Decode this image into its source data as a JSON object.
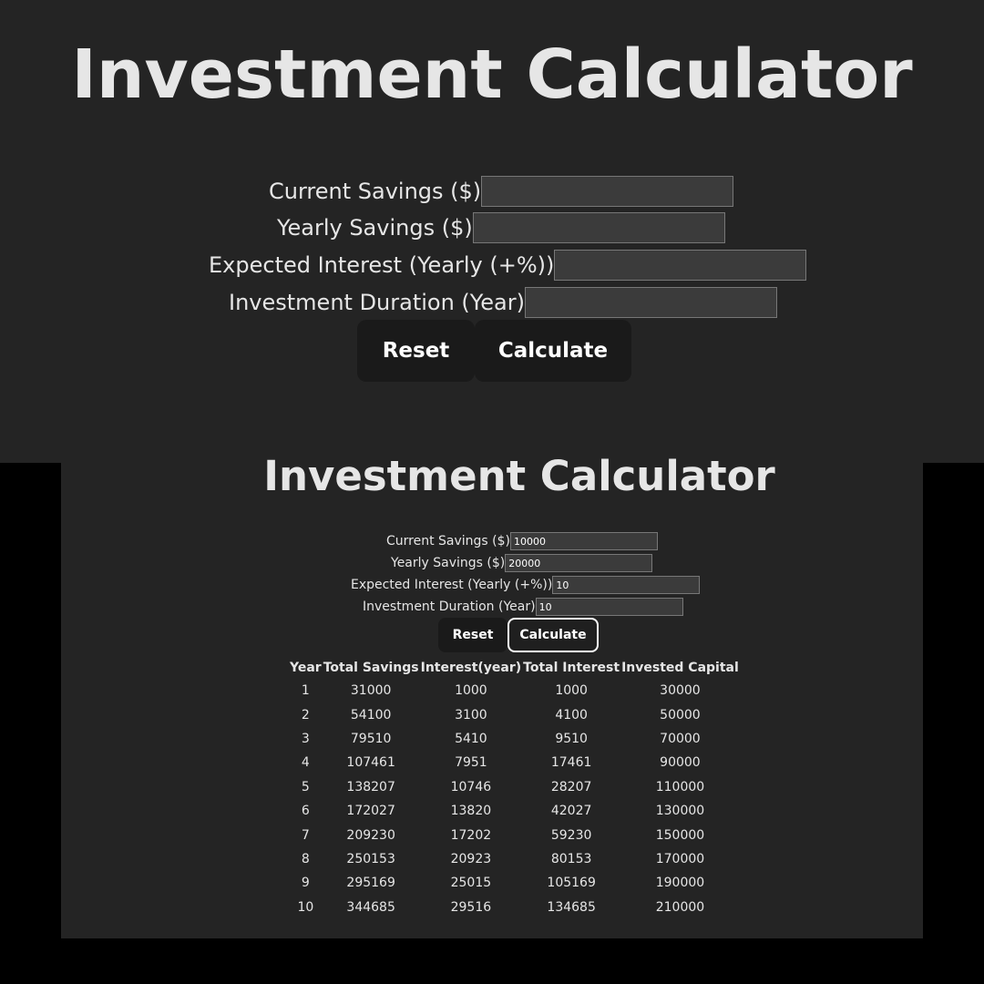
{
  "top": {
    "title": "Investment Calculator",
    "labels": {
      "current_savings": "Current Savings ($)",
      "yearly_savings": "Yearly Savings ($)",
      "expected_interest": "Expected Interest (Yearly (+%))",
      "duration": "Investment Duration (Year)"
    },
    "values": {
      "current_savings": "",
      "yearly_savings": "",
      "expected_interest": "",
      "duration": ""
    },
    "reset_label": "Reset",
    "calculate_label": "Calculate"
  },
  "bottom": {
    "title": "Investment Calculator",
    "labels": {
      "current_savings": "Current Savings ($)",
      "yearly_savings": "Yearly Savings ($)",
      "expected_interest": "Expected Interest (Yearly (+%))",
      "duration": "Investment Duration (Year)"
    },
    "values": {
      "current_savings": "10000",
      "yearly_savings": "20000",
      "expected_interest": "10",
      "duration": "10"
    },
    "reset_label": "Reset",
    "calculate_label": "Calculate"
  },
  "table": {
    "headers": [
      "Year",
      "Total Savings",
      "Interest(year)",
      "Total Interest",
      "Invested Capital"
    ],
    "rows": [
      [
        "1",
        "31000",
        "1000",
        "1000",
        "30000"
      ],
      [
        "2",
        "54100",
        "3100",
        "4100",
        "50000"
      ],
      [
        "3",
        "79510",
        "5410",
        "9510",
        "70000"
      ],
      [
        "4",
        "107461",
        "7951",
        "17461",
        "90000"
      ],
      [
        "5",
        "138207",
        "10746",
        "28207",
        "110000"
      ],
      [
        "6",
        "172027",
        "13820",
        "42027",
        "130000"
      ],
      [
        "7",
        "209230",
        "17202",
        "59230",
        "150000"
      ],
      [
        "8",
        "250153",
        "20923",
        "80153",
        "170000"
      ],
      [
        "9",
        "295169",
        "25015",
        "105169",
        "190000"
      ],
      [
        "10",
        "344685",
        "29516",
        "134685",
        "210000"
      ]
    ]
  }
}
